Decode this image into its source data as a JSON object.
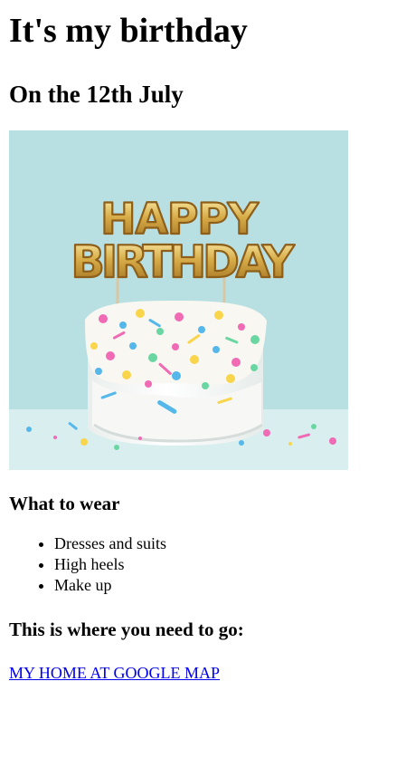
{
  "page": {
    "title": "It's my birthday",
    "date": "On the 12th July"
  },
  "hero": {
    "alt": "Happy Birthday cake",
    "topper_text": "HAPPY BIRTHDAY",
    "colors": {
      "background_top": "#9fd2d6",
      "background_bottom": "#d6eeef",
      "cake": "#f5f7f4",
      "balloon_gold": "#d7ac48",
      "sprinkle_pink": "#f06ab4",
      "sprinkle_yellow": "#f8d54b",
      "sprinkle_blue": "#55b7ea",
      "sprinkle_green": "#6ad6a2"
    }
  },
  "wear": {
    "title": "What to wear",
    "items": [
      "Dresses and suits",
      "High heels",
      "Make up"
    ]
  },
  "directions": {
    "title": "This is where you need to go:",
    "link_text": "MY HOME AT GOOGLE MAP"
  }
}
